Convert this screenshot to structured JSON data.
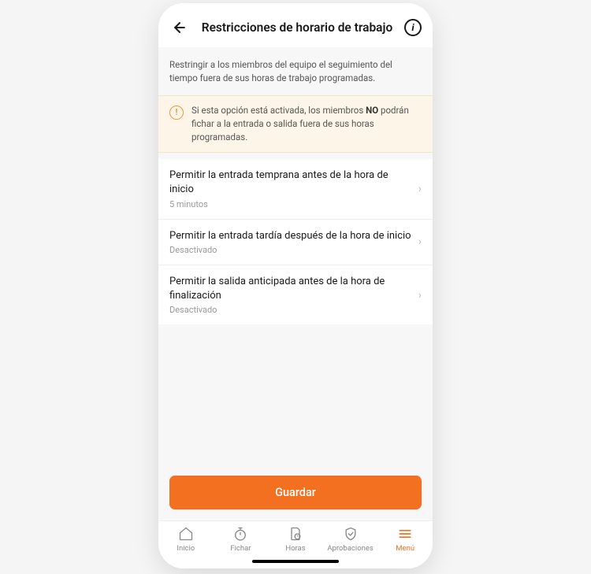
{
  "header": {
    "title": "Restricciones de horario de trabajo"
  },
  "description": "Restringir a los miembros del equipo el seguimiento del tiempo fuera de sus horas de trabajo programadas.",
  "warning": {
    "prefix": "Si esta opción está activada, los miembros ",
    "bold": "NO",
    "suffix": " podrán fichar a la entrada o salida fuera de sus horas programadas."
  },
  "options": [
    {
      "title": "Permitir la entrada temprana antes de la hora de inicio",
      "subtitle": "5 minutos"
    },
    {
      "title": "Permitir la entrada tardía después de la hora de inicio",
      "subtitle": "Desactivado"
    },
    {
      "title": "Permitir la salida anticipada antes de la hora de finalización",
      "subtitle": "Desactivado"
    }
  ],
  "saveButton": "Guardar",
  "tabs": {
    "home": "Inicio",
    "clock": "Fichar",
    "hours": "Horas",
    "approvals": "Aprobaciones",
    "menu": "Menú"
  }
}
